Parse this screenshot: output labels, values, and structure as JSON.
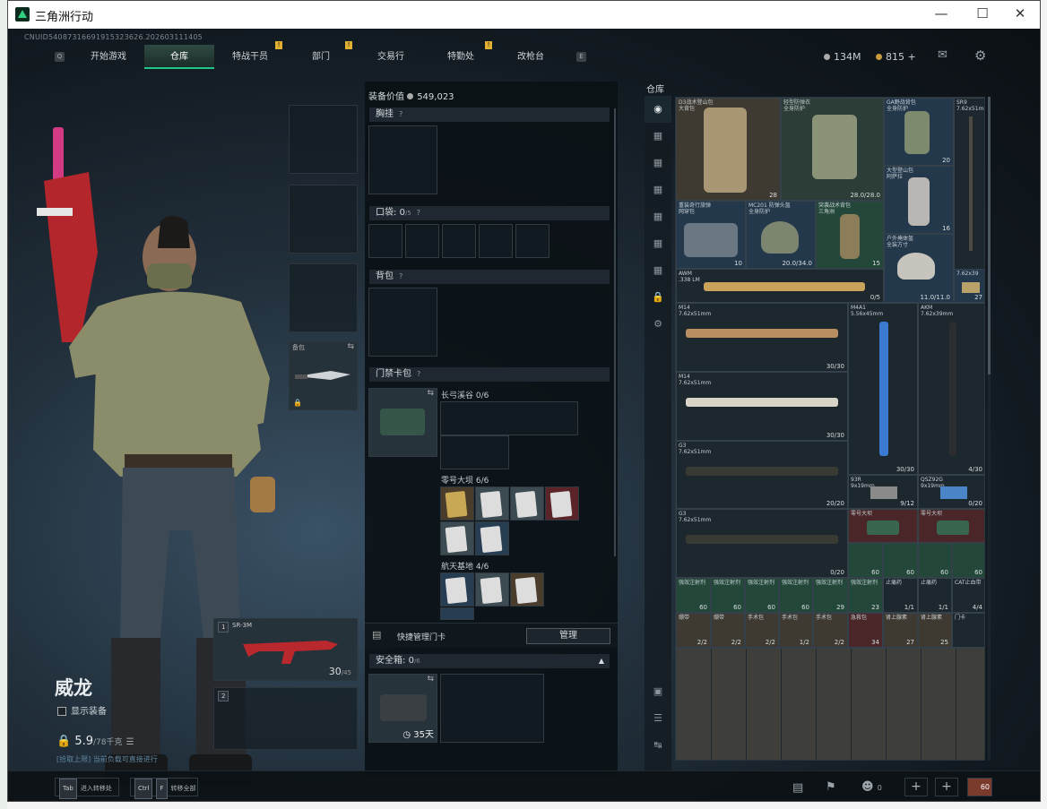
{
  "window": {
    "title": "三角洲行动"
  },
  "uid": "CNUID54087316691915323626.202603111405",
  "nav": {
    "items": [
      {
        "label": "开始游戏",
        "badge": ""
      },
      {
        "label": "仓库",
        "badge": "",
        "active": true
      },
      {
        "label": "特战干员",
        "badge": "!"
      },
      {
        "label": "部门",
        "badge": "!"
      },
      {
        "label": "交易行",
        "badge": ""
      },
      {
        "label": "特勤处",
        "badge": "!"
      },
      {
        "label": "改枪台",
        "badge": ""
      }
    ],
    "left_key": "Q",
    "right_key": "E"
  },
  "currency": {
    "silver": "134M",
    "gold": "815",
    "plus": "+"
  },
  "character": {
    "name": "威龙",
    "show_gear": "显示装备",
    "weight": "5.9",
    "weight_max": "/78千克",
    "capacity_hint": "[拾取上限] 当前负载可直接进行"
  },
  "slots": {
    "knife_label": "备包",
    "weapon1": {
      "index": "1",
      "name": "SR-3M",
      "ammo": "30",
      "ammo_max": "/45"
    },
    "weapon2": {
      "index": "2"
    }
  },
  "equipment": {
    "value_label": "装备价值",
    "value": "549,023",
    "chest": "胸挂",
    "chest_q": "?",
    "pocket": "口袋",
    "pocket_count": "0",
    "pocket_max": "/5",
    "pocket_q": "?",
    "backpack": "背包",
    "backpack_q": "?",
    "keycard": "门禁卡包",
    "keycard_q": "?",
    "groups": [
      {
        "label": "长弓溪谷",
        "count": "0/6"
      },
      {
        "label": "零号大坝",
        "count": "6/6"
      },
      {
        "label": "航天基地",
        "count": "4/6"
      }
    ],
    "quick_manage_label": "快捷管理门卡",
    "manage_btn": "管理",
    "safebox_label": "安全箱",
    "safebox_count": "0",
    "safebox_max": "/6",
    "safebox_days": "35天"
  },
  "storage": {
    "title": "仓库",
    "items": [
      {
        "name": "D3战术登山包\n大背包",
        "count": "28"
      },
      {
        "name": "轻型防弹衣\n全身防护",
        "count": "28.0/28.0"
      },
      {
        "name": "GA野战背包\n全身防护",
        "count": "20"
      },
      {
        "name": "SR9\n7.62x51mm",
        "count": ""
      },
      {
        "name": "重装奇行旅弹\n网穿包",
        "count": "10"
      },
      {
        "name": "MC201 防弹头盔\n全身防护",
        "count": "20.0/34.0"
      },
      {
        "name": "突袭战术背包\n三角洲",
        "count": "15"
      },
      {
        "name": "大型登山包\n阿萨拉",
        "count": "16"
      },
      {
        "name": "户外掩体盔\n全装方寸",
        "count": "11.0/11.0"
      },
      {
        "name": "AWM\n.338 LM",
        "count": "0/5"
      },
      {
        "name": "7.62x39",
        "count": "27"
      },
      {
        "name": "M14\n7.62x51mm",
        "count": "30/30"
      },
      {
        "name": "M4A1\n5.56x45mm",
        "count": "30/30"
      },
      {
        "name": "AKM\n7.62x39mm",
        "count": "4/30"
      },
      {
        "name": "M14\n7.62x51mm",
        "count": "30/30"
      },
      {
        "name": "G3\n7.62x51mm",
        "count": "20/20"
      },
      {
        "name": "93R\n9x19mm",
        "count": "9/12"
      },
      {
        "name": "QSZ92G\n9x19mm",
        "count": "0/20"
      },
      {
        "name": "G3\n7.62x51mm",
        "count": "0/20"
      },
      {
        "name": "零号大坝",
        "count": ""
      },
      {
        "name": "零号大坝",
        "count": ""
      },
      {
        "name": "强效注射剂",
        "count": "60"
      },
      {
        "name": "强效注射剂",
        "count": "60"
      },
      {
        "name": "强效注射剂",
        "count": "60"
      },
      {
        "name": "强效注射剂",
        "count": "60"
      },
      {
        "name": "强效注射剂",
        "count": "60"
      },
      {
        "name": "强效注射剂",
        "count": "60"
      },
      {
        "name": "强效注射剂",
        "count": "60"
      },
      {
        "name": "强效注射剂",
        "count": "60"
      },
      {
        "name": "强效注射剂",
        "count": "29"
      },
      {
        "name": "强效注射剂",
        "count": "23"
      },
      {
        "name": "止痛药",
        "count": "1/1"
      },
      {
        "name": "止痛药",
        "count": "1/1"
      },
      {
        "name": "CAT止血带",
        "count": "4/4"
      },
      {
        "name": "CAT止血带",
        "count": "4/4"
      },
      {
        "name": "绷带",
        "count": "2/2"
      },
      {
        "name": "绷带",
        "count": "2/2"
      },
      {
        "name": "手术包",
        "count": "2/2"
      },
      {
        "name": "手术包",
        "count": "1/2"
      },
      {
        "name": "手术包",
        "count": "2/2"
      },
      {
        "name": "急救包",
        "count": "34"
      },
      {
        "name": "肾上腺素",
        "count": "27"
      },
      {
        "name": "肾上腺素",
        "count": "25"
      },
      {
        "name": "门卡",
        "count": ""
      }
    ]
  },
  "bottom": {
    "tab_key": "Tab",
    "tab_label": "进入转移处",
    "ctrl_key": "Ctrl",
    "f_key": "F",
    "sort_label": "转移全部",
    "team_count": "0",
    "avatar_level": "60"
  }
}
